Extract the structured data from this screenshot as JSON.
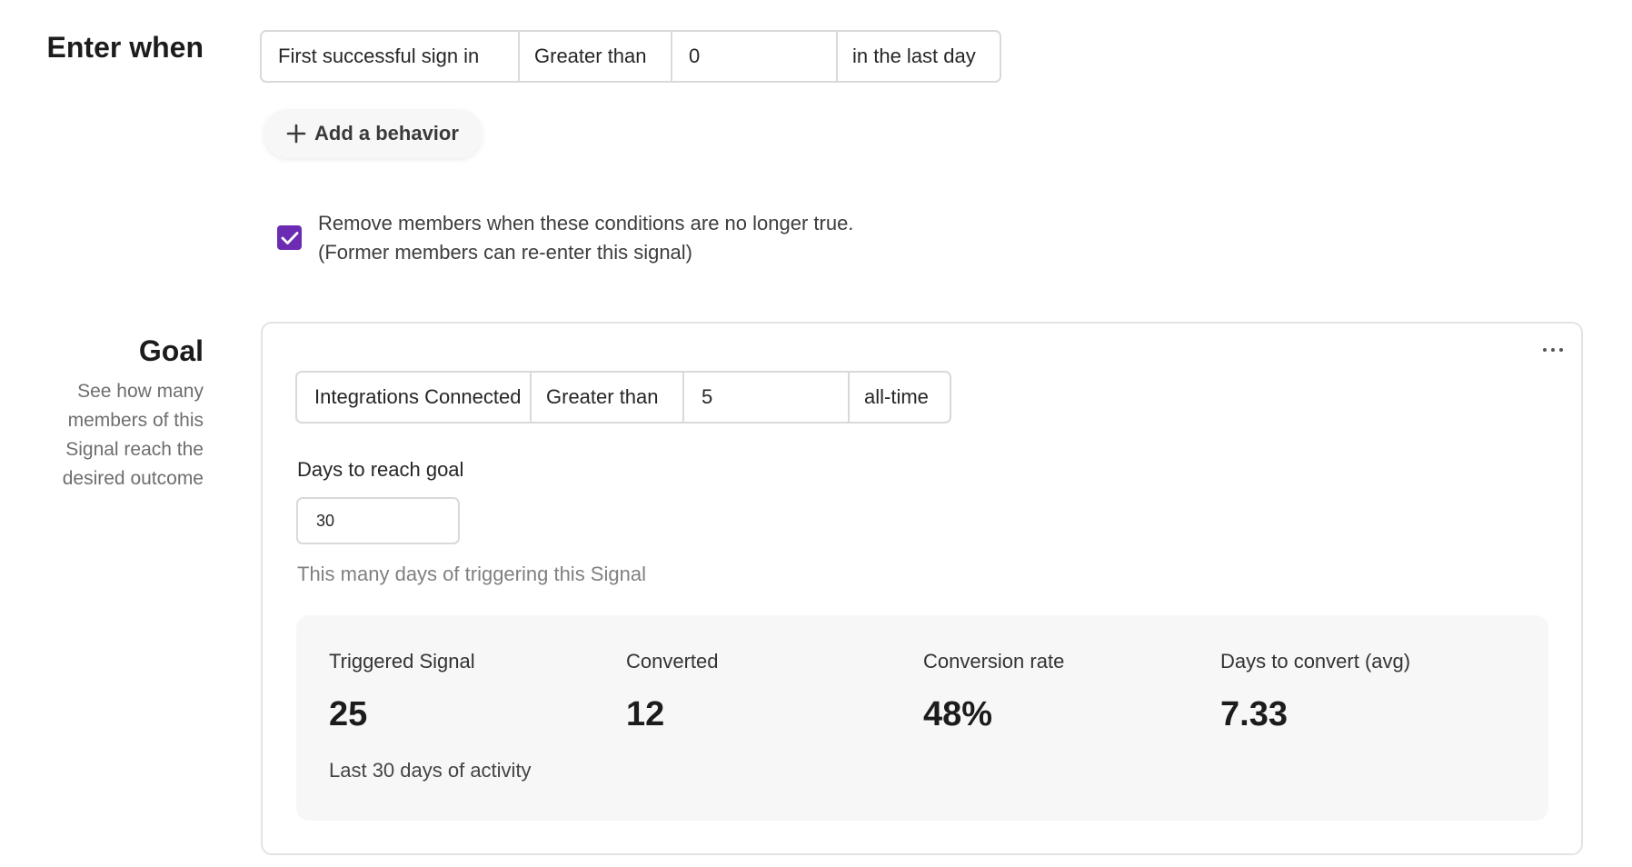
{
  "enter_when": {
    "title": "Enter when",
    "condition": {
      "behavior": "First successful sign in",
      "operator": "Greater than",
      "value": "0",
      "timeframe": "in the last day"
    },
    "add_behavior_label": "Add a behavior",
    "remove_members": {
      "checked": true,
      "line1": "Remove members when these conditions are no longer true.",
      "line2": "(Former members can re-enter this signal)"
    }
  },
  "goal": {
    "title": "Goal",
    "description": "See how many members of this Signal reach the desired outcome",
    "condition": {
      "behavior": "Integrations Connected",
      "operator": "Greater than",
      "value": "5",
      "timeframe": "all-time"
    },
    "days_label": "Days to reach goal",
    "days_value": "30",
    "days_help": "This many days of triggering this Signal",
    "stats": [
      {
        "label": "Triggered Signal",
        "value": "25"
      },
      {
        "label": "Converted",
        "value": "12"
      },
      {
        "label": "Conversion rate",
        "value": "48%"
      },
      {
        "label": "Days to convert (avg)",
        "value": "7.33"
      }
    ],
    "stats_footer": "Last 30 days of activity"
  },
  "icons": {
    "add": "plus-icon",
    "more": "more-horizontal-icon",
    "check": "checkmark-icon"
  },
  "colors": {
    "checkbox_accent": "#6b2bb3"
  }
}
